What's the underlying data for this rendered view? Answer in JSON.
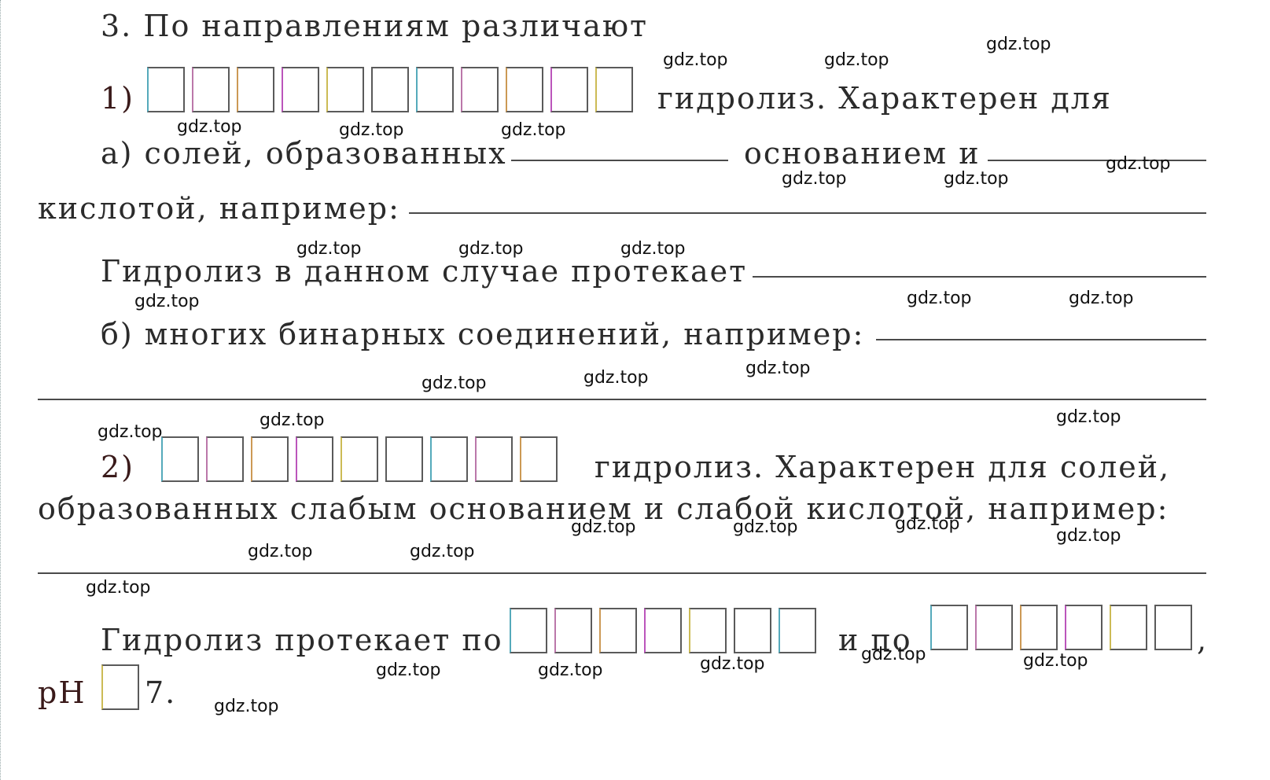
{
  "task": {
    "heading": "3. По направлениям различают",
    "item1": {
      "label": "1)",
      "box_count": 11,
      "after_boxes": "гидролиз. Характерен для",
      "a_start": "а) солей, образованных",
      "a_mid": "основанием и",
      "a_cont": "кислотой, например:",
      "hydrolysis_line": "Гидролиз в данном случае протекает",
      "b_text": "б) многих бинарных соединений, например:"
    },
    "item2": {
      "label": "2)",
      "box_count": 9,
      "after_boxes": "гидролиз. Характерен для солей,",
      "line2": "образованных слабым основанием и слабой кислотой, например:",
      "proceeds_text": "Гидролиз протекает по",
      "boxes_a_count": 7,
      "conj": "и по",
      "boxes_b_count": 6,
      "comma": ",",
      "ph_label": "pH",
      "ph_value": "7."
    }
  },
  "watermark": "gdz.top"
}
